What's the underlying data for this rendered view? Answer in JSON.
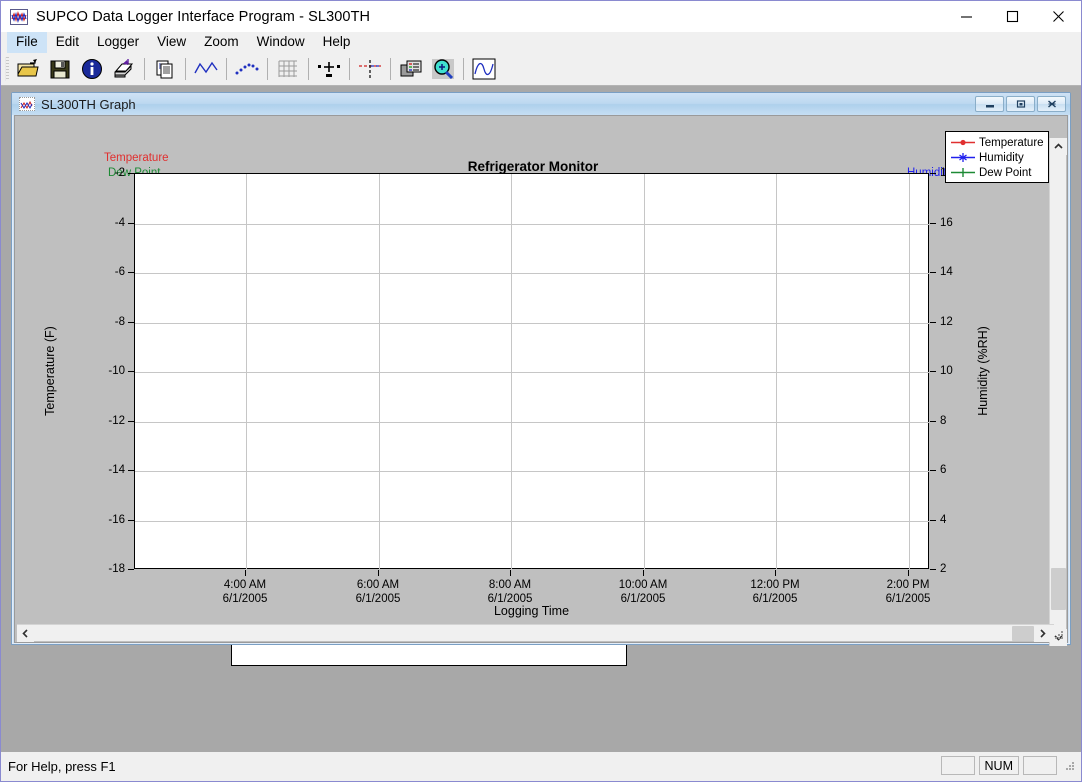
{
  "window": {
    "title": "SUPCO Data Logger Interface Program - SL300TH",
    "icon": "app-waveform-icon",
    "controls": {
      "minimize": "minimize",
      "maximize": "maximize",
      "close": "close"
    }
  },
  "menubar": {
    "items": [
      {
        "label": "File",
        "active": true
      },
      {
        "label": "Edit",
        "active": false
      },
      {
        "label": "Logger",
        "active": false
      },
      {
        "label": "View",
        "active": false
      },
      {
        "label": "Zoom",
        "active": false
      },
      {
        "label": "Window",
        "active": false
      },
      {
        "label": "Help",
        "active": false
      }
    ]
  },
  "toolbar": {
    "buttons": [
      {
        "name": "open-folder-icon",
        "title": "Open"
      },
      {
        "name": "save-floppy-icon",
        "title": "Save"
      },
      {
        "name": "info-icon",
        "title": "Info"
      },
      {
        "name": "print-icon",
        "title": "Print"
      },
      {
        "name": "copy-icon",
        "title": "Copy"
      },
      {
        "name": "line-graph-icon",
        "title": "Line Graph"
      },
      {
        "name": "scatter-plot-icon",
        "title": "Scatter Plot"
      },
      {
        "name": "grid-icon",
        "title": "Grid"
      },
      {
        "name": "markers-icon",
        "title": "Markers"
      },
      {
        "name": "crosshair-icon",
        "title": "Crosshair"
      },
      {
        "name": "legend-icon",
        "title": "Legend"
      },
      {
        "name": "zoom-magnifier-icon",
        "title": "Zoom"
      },
      {
        "name": "waveform-icon",
        "title": "Waveform"
      }
    ]
  },
  "mdi_child": {
    "title": "SL300TH Graph",
    "icon": "graph-icon",
    "controls": {
      "minimize": "minimize",
      "restore": "restore",
      "close": "close"
    }
  },
  "chart_data": {
    "type": "line",
    "title": "Refrigerator Monitor",
    "xlabel": "Logging Time",
    "ylabel": "Temperature (F)",
    "y2label": "Humidity (%RH)",
    "grid": true,
    "legend_position": "top-right",
    "corner_labels": {
      "temperature": "Temperature",
      "dew_point": "Dew Point",
      "humidity": "Humidity"
    },
    "x_ticks": [
      {
        "time": "4:00 AM",
        "date": "6/1/2005"
      },
      {
        "time": "6:00 AM",
        "date": "6/1/2005"
      },
      {
        "time": "8:00 AM",
        "date": "6/1/2005"
      },
      {
        "time": "10:00 AM",
        "date": "6/1/2005"
      },
      {
        "time": "12:00 PM",
        "date": "6/1/2005"
      },
      {
        "time": "2:00 PM",
        "date": "6/1/2005"
      }
    ],
    "y_left_ticks": [
      -2,
      -4,
      -6,
      -8,
      -10,
      -12,
      -14,
      -16,
      -18
    ],
    "ylim": [
      -18,
      -2
    ],
    "y_right_ticks": [
      18,
      16,
      14,
      12,
      10,
      8,
      6,
      4,
      2
    ],
    "y2lim": [
      2,
      18
    ],
    "series": [
      {
        "name": "Temperature",
        "color": "#e03030",
        "marker": "circle",
        "values": []
      },
      {
        "name": "Humidity",
        "color": "#2020ee",
        "marker": "asterisk",
        "values": []
      },
      {
        "name": "Dew Point",
        "color": "#1d8a35",
        "marker": "plus",
        "values": []
      }
    ]
  },
  "scrollbars": {
    "vertical": {
      "up": "scroll-up",
      "down": "scroll-down"
    },
    "horizontal": {
      "left": "scroll-left",
      "right": "scroll-right"
    }
  },
  "statusbar": {
    "hint": "For Help, press F1",
    "panes": [
      "",
      "NUM",
      ""
    ]
  }
}
